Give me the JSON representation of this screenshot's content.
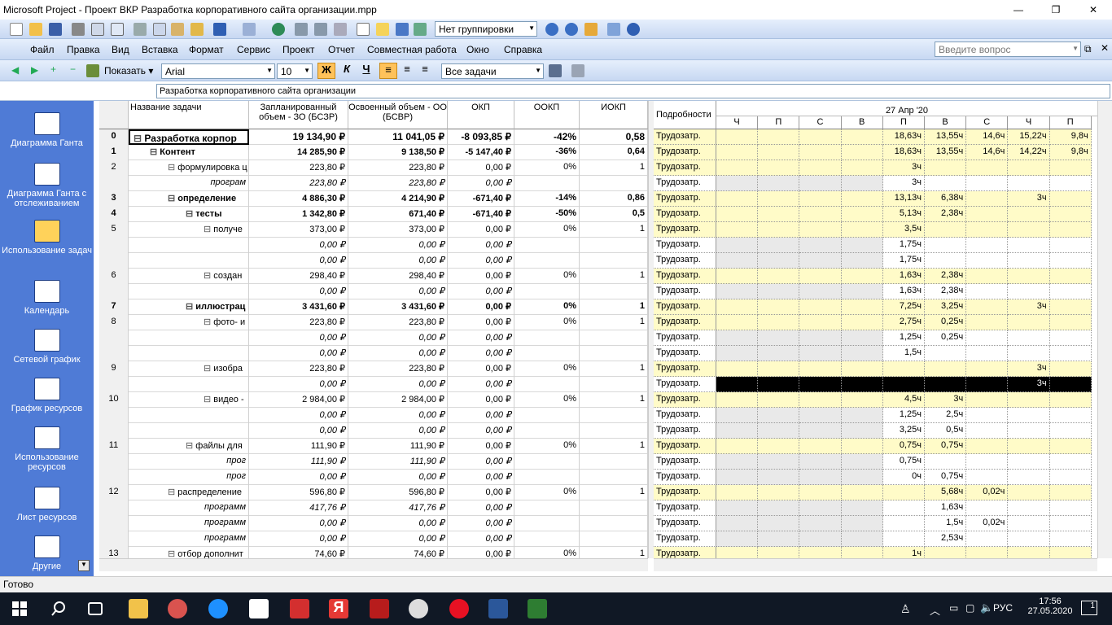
{
  "window": {
    "title": "Microsoft Project - Проект ВКР Разработка корпоративного сайта организации.mpp"
  },
  "toolbar1": {
    "grouping": "Нет группировки"
  },
  "menu": [
    "Файл",
    "Правка",
    "Вид",
    "Вставка",
    "Формат",
    "Сервис",
    "Проект",
    "Отчет",
    "Совместная работа",
    "Окно",
    "Справка"
  ],
  "help_placeholder": "Введите вопрос",
  "toolbar2": {
    "show_label": "Показать",
    "font": "Arial",
    "font_size": "10",
    "bold": "Ж",
    "italic": "К",
    "underline": "Ч",
    "filter": "Все задачи"
  },
  "entry_value": "Разработка корпоративного сайта организации",
  "viewbar": {
    "items": [
      "Диаграмма Ганта",
      "Диаграмма Ганта с отслеживанием",
      "Использование задач",
      "Календарь",
      "Сетевой график",
      "График ресурсов",
      "Использование ресурсов",
      "Лист ресурсов",
      "Другие"
    ]
  },
  "sheet": {
    "columns": [
      "Название задачи",
      "Запланированный объем - ЗО (БСЗР)",
      "Освоенный объем - ОО (БСВР)",
      "ОКП",
      "ООКП",
      "ИОКП"
    ],
    "rows": [
      {
        "id": "0",
        "name": "Разработка корпор",
        "zo": "19 134,90 ₽",
        "oo": "11 041,05 ₽",
        "okp": "-8 093,85 ₽",
        "ookp": "-42%",
        "iokp": "0,58",
        "lvl": 0,
        "kind": "sum0"
      },
      {
        "id": "1",
        "name": "Контент",
        "zo": "14 285,90 ₽",
        "oo": "9 138,50 ₽",
        "okp": "-5 147,40 ₽",
        "ookp": "-36%",
        "iokp": "0,64",
        "lvl": 1,
        "kind": "sum"
      },
      {
        "id": "2",
        "name": "формулировка ц",
        "zo": "223,80 ₽",
        "oo": "223,80 ₽",
        "okp": "0,00 ₽",
        "ookp": "0%",
        "iokp": "1",
        "lvl": 2,
        "kind": "task"
      },
      {
        "id": "",
        "name": "програм",
        "zo": "223,80 ₽",
        "oo": "223,80 ₽",
        "okp": "0,00 ₽",
        "ookp": "",
        "iokp": "",
        "lvl": 3,
        "kind": "asg"
      },
      {
        "id": "3",
        "name": "определение ",
        "zo": "4 886,30 ₽",
        "oo": "4 214,90 ₽",
        "okp": "-671,40 ₽",
        "ookp": "-14%",
        "iokp": "0,86",
        "lvl": 2,
        "kind": "sum"
      },
      {
        "id": "4",
        "name": "тесты",
        "zo": "1 342,80 ₽",
        "oo": "671,40 ₽",
        "okp": "-671,40 ₽",
        "ookp": "-50%",
        "iokp": "0,5",
        "lvl": 3,
        "kind": "sum"
      },
      {
        "id": "5",
        "name": "получе",
        "zo": "373,00 ₽",
        "oo": "373,00 ₽",
        "okp": "0,00 ₽",
        "ookp": "0%",
        "iokp": "1",
        "lvl": 4,
        "kind": "task"
      },
      {
        "id": "",
        "name": "",
        "zo": "0,00 ₽",
        "oo": "0,00 ₽",
        "okp": "0,00 ₽",
        "ookp": "",
        "iokp": "",
        "lvl": 5,
        "kind": "asg"
      },
      {
        "id": "",
        "name": "",
        "zo": "0,00 ₽",
        "oo": "0,00 ₽",
        "okp": "0,00 ₽",
        "ookp": "",
        "iokp": "",
        "lvl": 5,
        "kind": "asg"
      },
      {
        "id": "6",
        "name": "создан",
        "zo": "298,40 ₽",
        "oo": "298,40 ₽",
        "okp": "0,00 ₽",
        "ookp": "0%",
        "iokp": "1",
        "lvl": 4,
        "kind": "task"
      },
      {
        "id": "",
        "name": "",
        "zo": "0,00 ₽",
        "oo": "0,00 ₽",
        "okp": "0,00 ₽",
        "ookp": "",
        "iokp": "",
        "lvl": 5,
        "kind": "asg"
      },
      {
        "id": "7",
        "name": "иллюстрац",
        "zo": "3 431,60 ₽",
        "oo": "3 431,60 ₽",
        "okp": "0,00 ₽",
        "ookp": "0%",
        "iokp": "1",
        "lvl": 3,
        "kind": "sum"
      },
      {
        "id": "8",
        "name": "фото- и",
        "zo": "223,80 ₽",
        "oo": "223,80 ₽",
        "okp": "0,00 ₽",
        "ookp": "0%",
        "iokp": "1",
        "lvl": 4,
        "kind": "task"
      },
      {
        "id": "",
        "name": "",
        "zo": "0,00 ₽",
        "oo": "0,00 ₽",
        "okp": "0,00 ₽",
        "ookp": "",
        "iokp": "",
        "lvl": 5,
        "kind": "asg"
      },
      {
        "id": "",
        "name": "",
        "zo": "0,00 ₽",
        "oo": "0,00 ₽",
        "okp": "0,00 ₽",
        "ookp": "",
        "iokp": "",
        "lvl": 5,
        "kind": "asg"
      },
      {
        "id": "9",
        "name": "изобра",
        "zo": "223,80 ₽",
        "oo": "223,80 ₽",
        "okp": "0,00 ₽",
        "ookp": "0%",
        "iokp": "1",
        "lvl": 4,
        "kind": "task"
      },
      {
        "id": "",
        "name": "",
        "zo": "0,00 ₽",
        "oo": "0,00 ₽",
        "okp": "0,00 ₽",
        "ookp": "",
        "iokp": "",
        "lvl": 5,
        "kind": "asg"
      },
      {
        "id": "10",
        "name": "видео -",
        "zo": "2 984,00 ₽",
        "oo": "2 984,00 ₽",
        "okp": "0,00 ₽",
        "ookp": "0%",
        "iokp": "1",
        "lvl": 4,
        "kind": "task"
      },
      {
        "id": "",
        "name": "",
        "zo": "0,00 ₽",
        "oo": "0,00 ₽",
        "okp": "0,00 ₽",
        "ookp": "",
        "iokp": "",
        "lvl": 5,
        "kind": "asg"
      },
      {
        "id": "",
        "name": "",
        "zo": "0,00 ₽",
        "oo": "0,00 ₽",
        "okp": "0,00 ₽",
        "ookp": "",
        "iokp": "",
        "lvl": 5,
        "kind": "asg"
      },
      {
        "id": "11",
        "name": "файлы для",
        "zo": "111,90 ₽",
        "oo": "111,90 ₽",
        "okp": "0,00 ₽",
        "ookp": "0%",
        "iokp": "1",
        "lvl": 3,
        "kind": "task"
      },
      {
        "id": "",
        "name": "прог",
        "zo": "111,90 ₽",
        "oo": "111,90 ₽",
        "okp": "0,00 ₽",
        "ookp": "",
        "iokp": "",
        "lvl": 4,
        "kind": "asg"
      },
      {
        "id": "",
        "name": "прог",
        "zo": "0,00 ₽",
        "oo": "0,00 ₽",
        "okp": "0,00 ₽",
        "ookp": "",
        "iokp": "",
        "lvl": 4,
        "kind": "asg"
      },
      {
        "id": "12",
        "name": "распределение",
        "zo": "596,80 ₽",
        "oo": "596,80 ₽",
        "okp": "0,00 ₽",
        "ookp": "0%",
        "iokp": "1",
        "lvl": 2,
        "kind": "task"
      },
      {
        "id": "",
        "name": "программ",
        "zo": "417,76 ₽",
        "oo": "417,76 ₽",
        "okp": "0,00 ₽",
        "ookp": "",
        "iokp": "",
        "lvl": 3,
        "kind": "asg"
      },
      {
        "id": "",
        "name": "программ",
        "zo": "0,00 ₽",
        "oo": "0,00 ₽",
        "okp": "0,00 ₽",
        "ookp": "",
        "iokp": "",
        "lvl": 3,
        "kind": "asg"
      },
      {
        "id": "",
        "name": "программ",
        "zo": "0,00 ₽",
        "oo": "0,00 ₽",
        "okp": "0,00 ₽",
        "ookp": "",
        "iokp": "",
        "lvl": 3,
        "kind": "asg"
      },
      {
        "id": "13",
        "name": "отбор дополнит",
        "zo": "74,60 ₽",
        "oo": "74,60 ₽",
        "okp": "0,00 ₽",
        "ookp": "0%",
        "iokp": "1",
        "lvl": 2,
        "kind": "task"
      }
    ]
  },
  "usage": {
    "details_header": "Подробности",
    "week": "27 Апр '20",
    "days": [
      "Ч",
      "П",
      "С",
      "В",
      "П",
      "В",
      "С",
      "Ч",
      "П"
    ],
    "detail_label": "Трудозатр.",
    "rows": [
      {
        "hl": true,
        "v": [
          "",
          "",
          "",
          "",
          "18,63ч",
          "13,55ч",
          "14,6ч",
          "15,22ч",
          "9,8ч"
        ]
      },
      {
        "hl": true,
        "v": [
          "",
          "",
          "",
          "",
          "18,63ч",
          "13,55ч",
          "14,6ч",
          "14,22ч",
          "9,8ч"
        ]
      },
      {
        "hl": true,
        "v": [
          "",
          "",
          "",
          "",
          "3ч",
          "",
          "",
          "",
          ""
        ]
      },
      {
        "hl": false,
        "v": [
          "",
          "",
          "",
          "",
          "3ч",
          "",
          "",
          "",
          ""
        ]
      },
      {
        "hl": true,
        "v": [
          "",
          "",
          "",
          "",
          "13,13ч",
          "6,38ч",
          "",
          "3ч",
          ""
        ]
      },
      {
        "hl": true,
        "v": [
          "",
          "",
          "",
          "",
          "5,13ч",
          "2,38ч",
          "",
          "",
          ""
        ]
      },
      {
        "hl": true,
        "v": [
          "",
          "",
          "",
          "",
          "3,5ч",
          "",
          "",
          "",
          ""
        ]
      },
      {
        "hl": false,
        "v": [
          "",
          "",
          "",
          "",
          "1,75ч",
          "",
          "",
          "",
          ""
        ]
      },
      {
        "hl": false,
        "v": [
          "",
          "",
          "",
          "",
          "1,75ч",
          "",
          "",
          "",
          ""
        ]
      },
      {
        "hl": true,
        "v": [
          "",
          "",
          "",
          "",
          "1,63ч",
          "2,38ч",
          "",
          "",
          ""
        ]
      },
      {
        "hl": false,
        "v": [
          "",
          "",
          "",
          "",
          "1,63ч",
          "2,38ч",
          "",
          "",
          ""
        ]
      },
      {
        "hl": true,
        "v": [
          "",
          "",
          "",
          "",
          "7,25ч",
          "3,25ч",
          "",
          "3ч",
          ""
        ]
      },
      {
        "hl": true,
        "v": [
          "",
          "",
          "",
          "",
          "2,75ч",
          "0,25ч",
          "",
          "",
          ""
        ]
      },
      {
        "hl": false,
        "v": [
          "",
          "",
          "",
          "",
          "1,25ч",
          "0,25ч",
          "",
          "",
          ""
        ]
      },
      {
        "hl": false,
        "v": [
          "",
          "",
          "",
          "",
          "1,5ч",
          "",
          "",
          "",
          ""
        ]
      },
      {
        "hl": true,
        "v": [
          "",
          "",
          "",
          "",
          "",
          "",
          "",
          "3ч",
          ""
        ]
      },
      {
        "hl": false,
        "sel": true,
        "v": [
          "",
          "",
          "",
          "",
          "",
          "",
          "",
          "3ч",
          ""
        ]
      },
      {
        "hl": true,
        "v": [
          "",
          "",
          "",
          "",
          "4,5ч",
          "3ч",
          "",
          "",
          ""
        ]
      },
      {
        "hl": false,
        "v": [
          "",
          "",
          "",
          "",
          "1,25ч",
          "2,5ч",
          "",
          "",
          ""
        ]
      },
      {
        "hl": false,
        "v": [
          "",
          "",
          "",
          "",
          "3,25ч",
          "0,5ч",
          "",
          "",
          ""
        ]
      },
      {
        "hl": true,
        "v": [
          "",
          "",
          "",
          "",
          "0,75ч",
          "0,75ч",
          "",
          "",
          ""
        ]
      },
      {
        "hl": false,
        "v": [
          "",
          "",
          "",
          "",
          "0,75ч",
          "",
          "",
          "",
          ""
        ]
      },
      {
        "hl": false,
        "v": [
          "",
          "",
          "",
          "",
          "0ч",
          "0,75ч",
          "",
          "",
          ""
        ]
      },
      {
        "hl": true,
        "v": [
          "",
          "",
          "",
          "",
          "",
          "5,68ч",
          "0,02ч",
          "",
          ""
        ]
      },
      {
        "hl": false,
        "v": [
          "",
          "",
          "",
          "",
          "",
          "1,63ч",
          "",
          "",
          ""
        ]
      },
      {
        "hl": false,
        "v": [
          "",
          "",
          "",
          "",
          "",
          "1,5ч",
          "0,02ч",
          "",
          ""
        ]
      },
      {
        "hl": false,
        "v": [
          "",
          "",
          "",
          "",
          "",
          "2,53ч",
          "",
          "",
          ""
        ]
      },
      {
        "hl": true,
        "v": [
          "",
          "",
          "",
          "",
          "1ч",
          "",
          "",
          "",
          ""
        ]
      }
    ]
  },
  "status": "Готово",
  "tray": {
    "lang": "РУС",
    "time": "17:56",
    "date": "27.05.2020",
    "notif_count": "1"
  }
}
